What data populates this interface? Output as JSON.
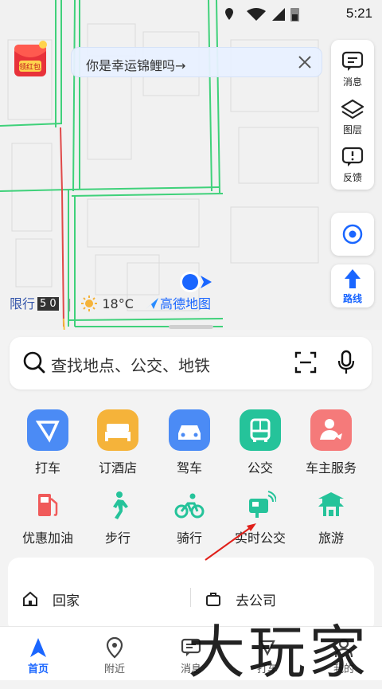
{
  "status_bar": {
    "time": "5:21"
  },
  "map": {
    "hongbao_label": "领红包",
    "banner_text": "你是幸运锦鲤吗→",
    "side_buttons": [
      {
        "label": "消息",
        "icon": "message-icon"
      },
      {
        "label": "图层",
        "icon": "layers-icon"
      },
      {
        "label": "反馈",
        "icon": "feedback-icon"
      }
    ],
    "route_label": "路线",
    "restriction_label": "限行",
    "restriction_value": "5 0",
    "temperature": "18°C",
    "logo_text": "高德地图"
  },
  "search": {
    "placeholder": "查找地点、公交、地铁"
  },
  "services_row1": [
    {
      "label": "打车",
      "color": "#4b8bf5"
    },
    {
      "label": "订酒店",
      "color": "#f5b33a"
    },
    {
      "label": "驾车",
      "color": "#4b8bf5"
    },
    {
      "label": "公交",
      "color": "#25c39a"
    },
    {
      "label": "车主服务",
      "color": "#f57a7a"
    }
  ],
  "services_row2": [
    {
      "label": "优惠加油",
      "color": "#f05a5a"
    },
    {
      "label": "步行",
      "color": "#25c39a"
    },
    {
      "label": "骑行",
      "color": "#25c39a"
    },
    {
      "label": "实时公交",
      "color": "#25c39a"
    },
    {
      "label": "旅游",
      "color": "#25c39a"
    }
  ],
  "addresses": {
    "home": "回家",
    "work": "去公司"
  },
  "tabs": [
    {
      "label": "首页",
      "active": true
    },
    {
      "label": "附近",
      "active": false
    },
    {
      "label": "消息",
      "active": false
    },
    {
      "label": "打车",
      "active": false
    },
    {
      "label": "我的",
      "active": false
    }
  ],
  "watermark": "大玩家",
  "colors": {
    "accent": "#1a66ff",
    "road": "#3fd17a"
  }
}
